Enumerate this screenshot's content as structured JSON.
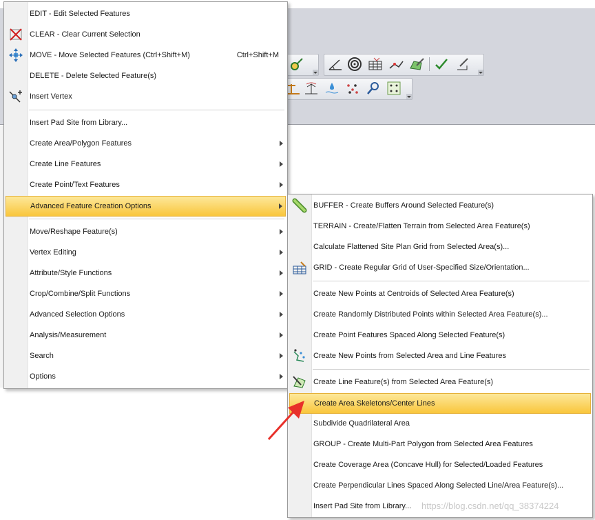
{
  "main_menu": {
    "items": [
      {
        "label": "EDIT - Edit Selected Features",
        "icon": "none"
      },
      {
        "label": "CLEAR - Clear Current Selection",
        "icon": "clear-selection-icon"
      },
      {
        "label": "MOVE - Move Selected Features (Ctrl+Shift+M)",
        "shortcut": "Ctrl+Shift+M",
        "icon": "move-icon"
      },
      {
        "label": "DELETE - Delete Selected Feature(s)",
        "icon": "none"
      },
      {
        "label": "Insert Vertex",
        "icon": "insert-vertex-icon"
      },
      {
        "label": "Insert Pad Site from Library..."
      },
      {
        "label": "Create Area/Polygon Features",
        "submenu": true
      },
      {
        "label": "Create Line Features",
        "submenu": true
      },
      {
        "label": "Create Point/Text Features",
        "submenu": true
      },
      {
        "label": "Advanced Feature Creation Options",
        "submenu": true,
        "highlighted": true
      },
      {
        "label": "Move/Reshape Feature(s)",
        "submenu": true
      },
      {
        "label": "Vertex Editing",
        "submenu": true
      },
      {
        "label": "Attribute/Style Functions",
        "submenu": true
      },
      {
        "label": "Crop/Combine/Split Functions",
        "submenu": true
      },
      {
        "label": "Advanced Selection Options",
        "submenu": true
      },
      {
        "label": "Analysis/Measurement",
        "submenu": true
      },
      {
        "label": "Search",
        "submenu": true
      },
      {
        "label": "Options",
        "submenu": true
      }
    ]
  },
  "submenu": {
    "items": [
      {
        "label": "BUFFER - Create Buffers Around Selected Feature(s)",
        "icon": "buffer-icon"
      },
      {
        "label": "TERRAIN - Create/Flatten Terrain from Selected Area Feature(s)"
      },
      {
        "label": "Calculate Flattened Site Plan Grid from Selected Area(s)..."
      },
      {
        "label": "GRID - Create Regular Grid of User-Specified Size/Orientation...",
        "icon": "grid-icon"
      },
      {
        "label": "Create New Points at Centroids of Selected Area Feature(s)"
      },
      {
        "label": "Create Randomly Distributed Points within Selected Area Feature(s)..."
      },
      {
        "label": "Create Point Features Spaced Along Selected Feature(s)"
      },
      {
        "label": "Create New Points from Selected Area and Line Features",
        "icon": "points-from-features-icon"
      },
      {
        "label": "Create Line Feature(s) from Selected Area Feature(s)",
        "icon": "line-from-area-icon"
      },
      {
        "label": "Create Area Skeletons/Center Lines",
        "highlighted": true
      },
      {
        "label": "Subdivide Quadrilateral Area"
      },
      {
        "label": "GROUP - Create Multi-Part Polygon from Selected Area Features"
      },
      {
        "label": "Create Coverage Area (Concave Hull) for Selected/Loaded Features"
      },
      {
        "label": "Create Perpendicular Lines Spaced Along Selected Line/Area Feature(s)..."
      },
      {
        "label": "Insert Pad Site from Library..."
      }
    ]
  },
  "watermark": "https://blog.csdn.net/qq_38374224",
  "colors": {
    "highlight": "#f9c63c",
    "arrow": "#e8302a"
  }
}
